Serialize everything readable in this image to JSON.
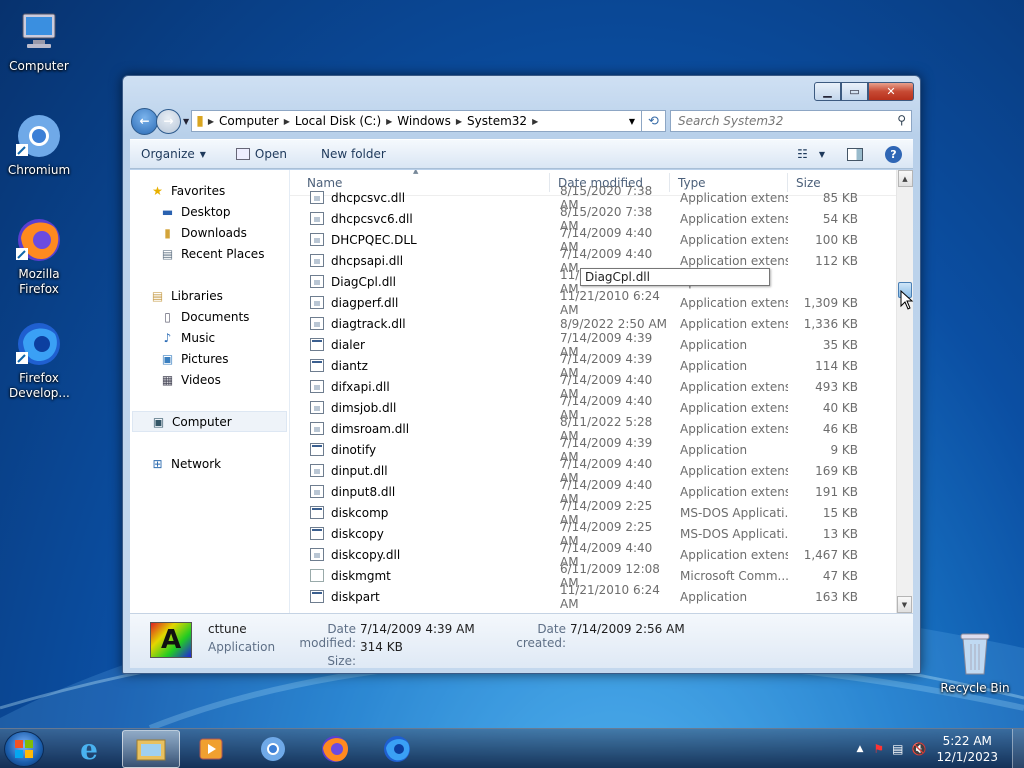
{
  "desktop": {
    "icons": [
      {
        "label": "Computer"
      },
      {
        "label": "Chromium"
      },
      {
        "label": "Mozilla Firefox"
      },
      {
        "label": "Firefox Develop..."
      },
      {
        "label": "Recycle Bin"
      }
    ]
  },
  "window": {
    "address": [
      "Computer",
      "Local Disk (C:)",
      "Windows",
      "System32"
    ],
    "search_placeholder": "Search System32",
    "toolbar": {
      "organize": "Organize",
      "open": "Open",
      "new_folder": "New folder"
    },
    "nav": {
      "favorites": "Favorites",
      "fav_items": [
        "Desktop",
        "Downloads",
        "Recent Places"
      ],
      "libraries": "Libraries",
      "lib_items": [
        "Documents",
        "Music",
        "Pictures",
        "Videos"
      ],
      "computer": "Computer",
      "network": "Network"
    },
    "columns": {
      "name": "Name",
      "date": "Date modified",
      "type": "Type",
      "size": "Size"
    },
    "files": [
      {
        "name": "dhcpcsvc.dll",
        "date": "8/15/2020 7:38 AM",
        "type": "Application extens...",
        "size": "85 KB",
        "kind": "dll"
      },
      {
        "name": "dhcpcsvc6.dll",
        "date": "8/15/2020 7:38 AM",
        "type": "Application extens...",
        "size": "54 KB",
        "kind": "dll"
      },
      {
        "name": "DHCPQEC.DLL",
        "date": "7/14/2009 4:40 AM",
        "type": "Application extens...",
        "size": "100 KB",
        "kind": "dll"
      },
      {
        "name": "dhcpsapi.dll",
        "date": "7/14/2009 4:40 AM",
        "type": "Application extens...",
        "size": "112 KB",
        "kind": "dll"
      },
      {
        "name": "DiagCpl.dll",
        "date": "11/21/2010 6:24 AM",
        "type": "Ap",
        "size": "",
        "kind": "dll"
      },
      {
        "name": "diagperf.dll",
        "date": "11/21/2010 6:24 AM",
        "type": "Application extens...",
        "size": "1,309 KB",
        "kind": "dll"
      },
      {
        "name": "diagtrack.dll",
        "date": "8/9/2022 2:50 AM",
        "type": "Application extens...",
        "size": "1,336 KB",
        "kind": "dll"
      },
      {
        "name": "dialer",
        "date": "7/14/2009 4:39 AM",
        "type": "Application",
        "size": "35 KB",
        "kind": "app"
      },
      {
        "name": "diantz",
        "date": "7/14/2009 4:39 AM",
        "type": "Application",
        "size": "114 KB",
        "kind": "app"
      },
      {
        "name": "difxapi.dll",
        "date": "7/14/2009 4:40 AM",
        "type": "Application extens...",
        "size": "493 KB",
        "kind": "dll"
      },
      {
        "name": "dimsjob.dll",
        "date": "7/14/2009 4:40 AM",
        "type": "Application extens...",
        "size": "40 KB",
        "kind": "dll"
      },
      {
        "name": "dimsroam.dll",
        "date": "8/11/2022 5:28 AM",
        "type": "Application extens...",
        "size": "46 KB",
        "kind": "dll"
      },
      {
        "name": "dinotify",
        "date": "7/14/2009 4:39 AM",
        "type": "Application",
        "size": "9 KB",
        "kind": "app"
      },
      {
        "name": "dinput.dll",
        "date": "7/14/2009 4:40 AM",
        "type": "Application extens...",
        "size": "169 KB",
        "kind": "dll"
      },
      {
        "name": "dinput8.dll",
        "date": "7/14/2009 4:40 AM",
        "type": "Application extens...",
        "size": "191 KB",
        "kind": "dll"
      },
      {
        "name": "diskcomp",
        "date": "7/14/2009 2:25 AM",
        "type": "MS-DOS Applicati...",
        "size": "15 KB",
        "kind": "app"
      },
      {
        "name": "diskcopy",
        "date": "7/14/2009 2:25 AM",
        "type": "MS-DOS Applicati...",
        "size": "13 KB",
        "kind": "app"
      },
      {
        "name": "diskcopy.dll",
        "date": "7/14/2009 4:40 AM",
        "type": "Application extens...",
        "size": "1,467 KB",
        "kind": "dll"
      },
      {
        "name": "diskmgmt",
        "date": "6/11/2009 12:08 AM",
        "type": "Microsoft Comm...",
        "size": "47 KB",
        "kind": "blank"
      },
      {
        "name": "diskpart",
        "date": "11/21/2010 6:24 AM",
        "type": "Application",
        "size": "163 KB",
        "kind": "app"
      }
    ],
    "tooltip": "DiagCpl.dll",
    "details": {
      "name": "cttune",
      "kind": "Application",
      "date_modified_label": "Date modified:",
      "date_modified": "7/14/2009 4:39 AM",
      "size_label": "Size:",
      "size": "314 KB",
      "date_created_label": "Date created:",
      "date_created": "7/14/2009 2:56 AM"
    }
  },
  "taskbar": {
    "time": "5:22 AM",
    "date": "12/1/2023"
  }
}
